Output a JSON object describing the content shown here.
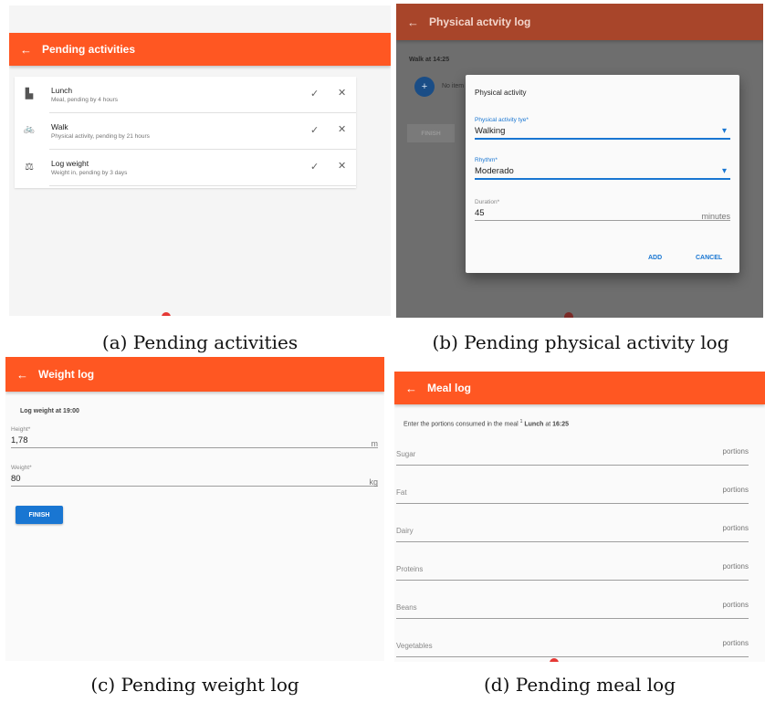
{
  "panels": {
    "a": {
      "title": "Pending activities",
      "back": "←",
      "items": [
        {
          "icon": "▙",
          "name": "Lunch",
          "sub": "Meal, pending by 4 hours",
          "check": "✓",
          "close": "✕"
        },
        {
          "icon": "🚲",
          "name": "Walk",
          "sub": "Physical activity, pending by 21 hours",
          "check": "✓",
          "close": "✕"
        },
        {
          "icon": "⚖",
          "name": "Log weight",
          "sub": "Weight in, pending by 3 days",
          "check": "✓",
          "close": "✕"
        }
      ],
      "caption": "(a) Pending activities"
    },
    "b": {
      "title": "Physical actvity log",
      "back": "←",
      "header_text": "Walk at 14:25",
      "fab": "+",
      "no_items": "No item",
      "finish": "FINISH",
      "dialog": {
        "title": "Physical activity",
        "type_label": "Physical activity tye*",
        "type_value": "Walking",
        "rhythm_label": "Rhythm*",
        "rhythm_value": "Moderado",
        "duration_label": "Duration*",
        "duration_value": "45",
        "duration_unit": "minutes",
        "add": "ADD",
        "cancel": "CANCEL",
        "dropdown_glyph": "▾"
      },
      "caption": "(b) Pending physical activity log"
    },
    "c": {
      "title": "Weight log",
      "back": "←",
      "header_text": "Log weight at 19:00",
      "height_label": "Height*",
      "height_value": "1,78",
      "height_unit": "m",
      "weight_label": "Weight*",
      "weight_value": "80",
      "weight_unit": "kg",
      "finish": "FINISH",
      "caption": "(c) Pending weight log"
    },
    "d": {
      "title": "Meal log",
      "back": "←",
      "header_prefix": "Enter the portions consumed in the meal",
      "header_sup": "1",
      "header_meal": "Lunch",
      "header_at": "at",
      "header_time": "16:25",
      "fields": [
        {
          "label": "Sugar",
          "unit": "portions"
        },
        {
          "label": "Fat",
          "unit": "portions"
        },
        {
          "label": "Dairy",
          "unit": "portions"
        },
        {
          "label": "Proteins",
          "unit": "portions"
        },
        {
          "label": "Beans",
          "unit": "portions"
        },
        {
          "label": "Vegetables",
          "unit": "portions"
        }
      ],
      "caption": "(d) Pending meal log"
    }
  },
  "colors": {
    "appbar": "#ff5722",
    "appbar_dim": "#a8452a",
    "accent": "#1976d2",
    "dot": "#e53935"
  }
}
